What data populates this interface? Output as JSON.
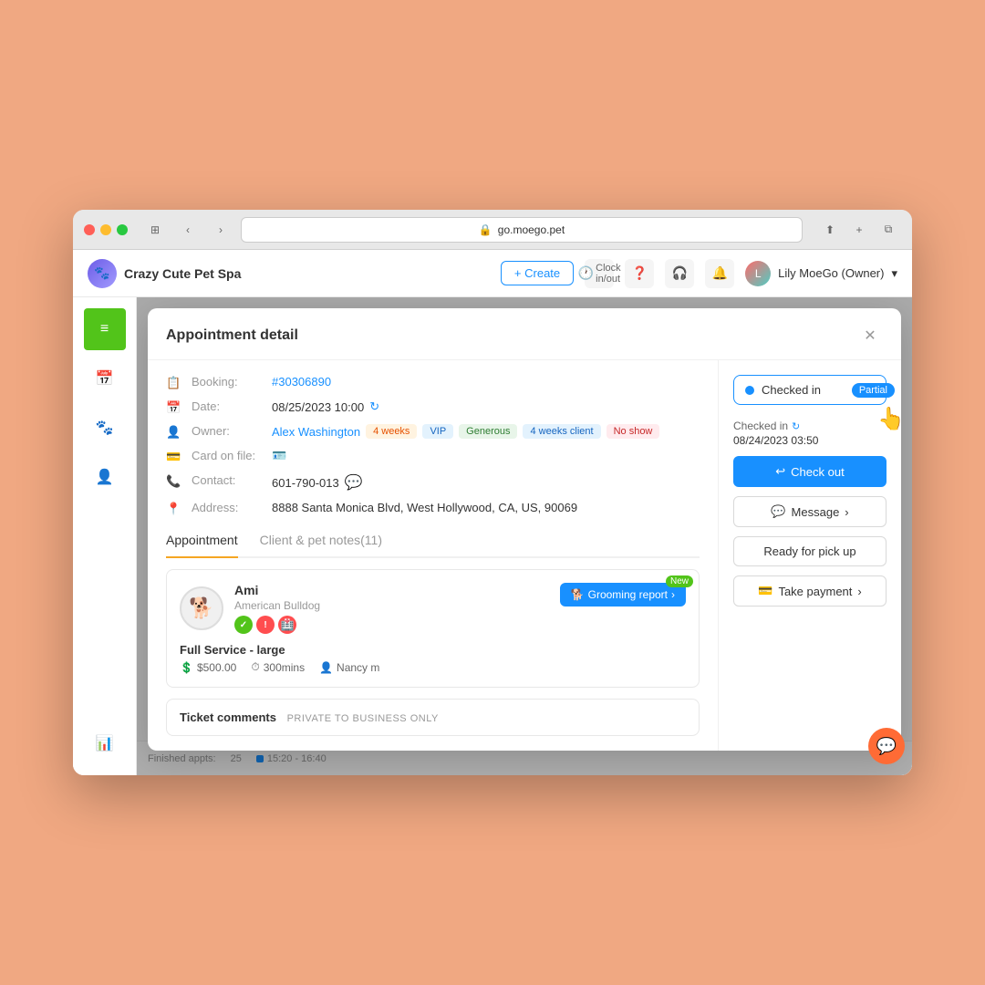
{
  "browser": {
    "url": "go.moego.pet",
    "favicon": "🔒"
  },
  "app": {
    "name": "Crazy Cute Pet Spa",
    "nav": {
      "create_label": "+ Create",
      "clock_label": "Clock in/out",
      "user_label": "Lily MoeGo (Owner)"
    }
  },
  "modal": {
    "title": "Appointment detail",
    "close_label": "×",
    "status": {
      "text": "Checked in",
      "badge": "Partial"
    },
    "fields": {
      "booking_label": "Booking:",
      "booking_value": "#30306890",
      "date_label": "Date:",
      "date_value": "08/25/2023 10:00",
      "owner_label": "Owner:",
      "owner_name": "Alex Washington",
      "owner_tags": [
        "4 weeks",
        "VIP",
        "Generous",
        "4 weeks client",
        "No show"
      ],
      "card_label": "Card on file:",
      "contact_label": "Contact:",
      "contact_value": "601-790-013",
      "address_label": "Address:",
      "address_value": "8888 Santa Monica Blvd, West Hollywood, CA, US, 90069"
    },
    "tabs": {
      "appointment": "Appointment",
      "client_notes": "Client & pet notes(11)"
    },
    "pet_card": {
      "name": "Ami",
      "breed": "American Bulldog",
      "service": "Full Service - large",
      "price": "$500.00",
      "duration": "300mins",
      "staff": "Nancy m",
      "grooming_report": "Grooming report",
      "new_label": "New"
    },
    "ticket_section": {
      "label": "Ticket comments",
      "private_note": "PRIVATE TO BUSINESS ONLY"
    },
    "right_panel": {
      "checked_in_label": "Checked in",
      "checked_in_date": "08/24/2023 03:50",
      "checkout_label": "Check out",
      "message_label": "Message",
      "ready_label": "Ready for pick up",
      "payment_label": "Take payment"
    }
  },
  "bottom_bar": {
    "finished_label": "Finished appts:",
    "finished_count": "25",
    "timeline_label": "15:20 - 16:40"
  },
  "sidebar": {
    "items": [
      {
        "icon": "≡",
        "label": "menu"
      },
      {
        "icon": "📅",
        "label": "calendar"
      },
      {
        "icon": "🐾",
        "label": "pets"
      },
      {
        "icon": "👤",
        "label": "clients"
      },
      {
        "icon": "📊",
        "label": "reports"
      }
    ]
  }
}
